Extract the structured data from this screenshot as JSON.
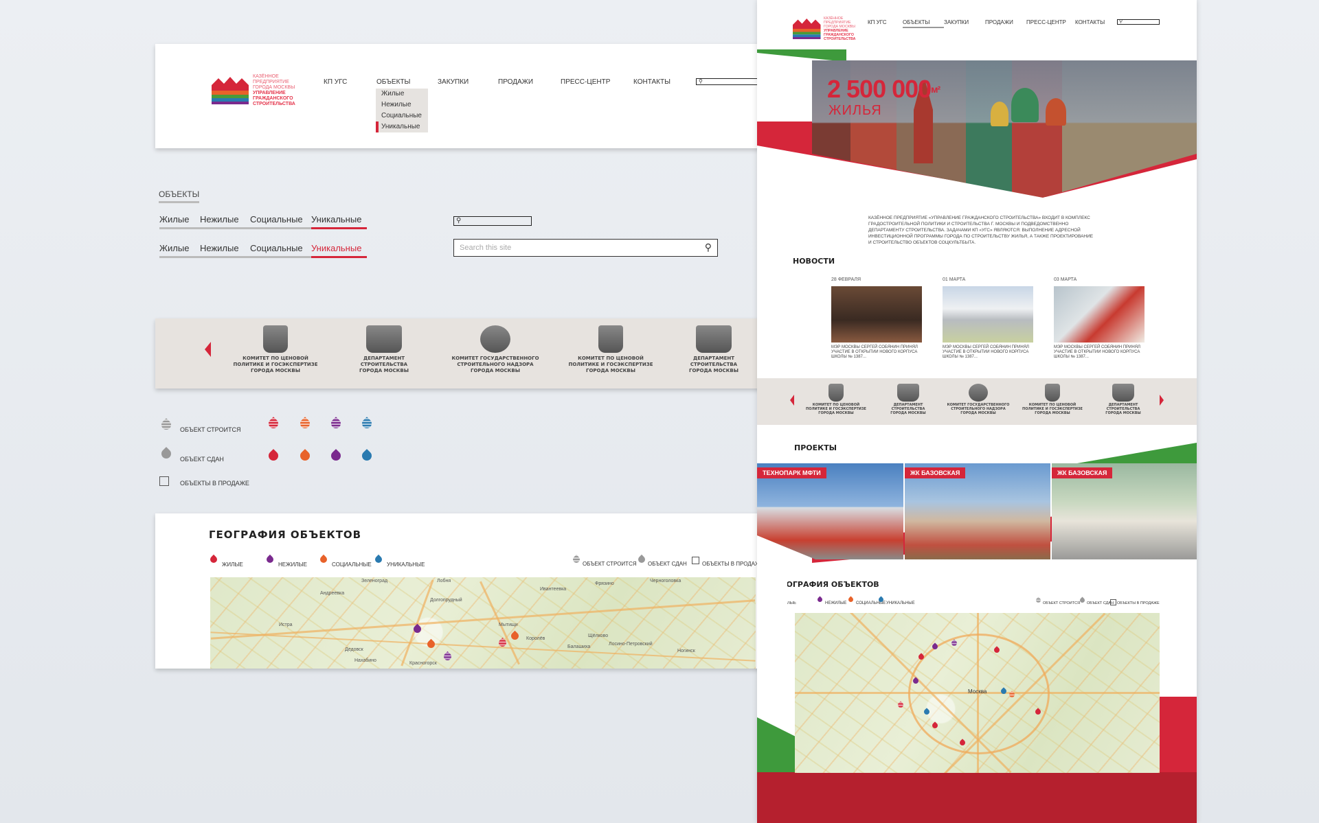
{
  "logo": {
    "line1": "КАЗЁННОЕ",
    "line2": "ПРЕДПРИЯТИЕ",
    "line3": "ГОРОДА МОСКВЫ",
    "line4": "УПРАВЛЕНИЕ",
    "line5": "ГРАЖДАНСКОГО",
    "line6": "СТРОИТЕЛЬСТВА"
  },
  "nav": {
    "items": [
      "КП УГС",
      "ОБЪЕКТЫ",
      "ЗАКУПКИ",
      "ПРОДАЖИ",
      "ПРЕСС-ЦЕНТР",
      "КОНТАКТЫ"
    ]
  },
  "dropdown": {
    "items": [
      "Жилые",
      "Нежилые",
      "Социальные",
      "Уникальные"
    ]
  },
  "objects_section": {
    "title": "ОБЪЕКТЫ",
    "tabs": [
      "Жилые",
      "Нежилые",
      "Социальные",
      "Уникальные"
    ]
  },
  "search": {
    "placeholder": "Search this site"
  },
  "carousel": {
    "items": [
      {
        "l1": "КОМИТЕТ ПО ЦЕНОВОЙ",
        "l2": "ПОЛИТИКЕ И ГОСЭКСПЕРТИЗЕ",
        "l3": "ГОРОДА МОСКВЫ"
      },
      {
        "l1": "ДЕПАРТАМЕНТ",
        "l2": "СТРОИТЕЛЬСТВА",
        "l3": "ГОРОДА МОСКВЫ"
      },
      {
        "l1": "КОМИТЕТ ГОСУДАРСТВЕННОГО",
        "l2": "СТРОИТЕЛЬНОГО НАДЗОРА",
        "l3": "ГОРОДА МОСКВЫ"
      },
      {
        "l1": "КОМИТЕТ ПО ЦЕНОВОЙ",
        "l2": "ПОЛИТИКЕ И ГОСЭКСПЕРТИЗЕ",
        "l3": "ГОРОДА МОСКВЫ"
      },
      {
        "l1": "ДЕПАРТАМЕНТ",
        "l2": "СТРОИТЕЛЬСТВА",
        "l3": "ГОРОДА МОСКВЫ"
      }
    ]
  },
  "legend": {
    "building": "ОБЪЕКТ СТРОИТСЯ",
    "done": "ОБЪЕКТ СДАН",
    "sale": "ОБЪЕКТЫ В ПРОДАЖЕ",
    "colors": [
      "#d5263a",
      "#e8622a",
      "#7a2a8e",
      "#2a7ab0"
    ]
  },
  "geo": {
    "title": "ГЕОГРАФИЯ ОБЪЕКТОВ",
    "types": [
      "ЖИЛЫЕ",
      "НЕЖИЛЫЕ",
      "СОЦИАЛЬНЫЕ",
      "УНИКАЛЬНЫЕ"
    ],
    "status": [
      "ОБЪЕКТ СТРОИТСЯ",
      "ОБЪЕКТ СДАН",
      "ОБЪЕКТЫ В ПРОДАЖЕ"
    ]
  },
  "map_towns": [
    "Зеленоград",
    "Андреевка",
    "Лобня",
    "Долгопрудный",
    "Ивантеевка",
    "Фрязино",
    "Черноголовка",
    "Истра",
    "Мытищи",
    "Королёв",
    "Щёлково",
    "Дедовск",
    "Балашиха",
    "Лосино-Петровский",
    "Ногинск",
    "Нахабино",
    "Красногорск",
    "Москва"
  ],
  "hero": {
    "number": "2 500 000",
    "unit": "м²",
    "caption": "ЖИЛЬЯ"
  },
  "about": {
    "text": "КАЗЁННОЕ ПРЕДПРИЯТИЕ «УПРАВЛЕНИЕ ГРАЖДАНСКОГО СТРОИТЕЛЬСТВА» ВХОДИТ В КОМПЛЕКС ГРАДОСТРОИТЕЛЬНОЙ ПОЛИТИКИ И СТРОИТЕЛЬСТВА Г. МОСКВЫ И ПОДВЕДОМСТВЕННО ДЕПАРТАМЕНТУ СТРОИТЕЛЬСТВА. ЗАДАЧАМИ КП «УГС» ЯВЛЯЮТСЯ: ВЫПОЛНЕНИЕ АДРЕСНОЙ ИНВЕСТИЦИОННОЙ ПРОГРАММЫ ГОРОДА ПО СТРОИТЕЛЬСТВУ ЖИЛЬЯ, А ТАКЖЕ ПРОЕКТИРОВАНИЕ И СТРОИТЕЛЬСТВО ОБЪЕКТОВ СОЦКУЛЬТБЫТА."
  },
  "news": {
    "title": "НОВОСТИ",
    "items": [
      {
        "date": "28 ФЕВРАЛЯ",
        "text": "МЭР МОСКВЫ СЕРГЕЙ СОБЯНИН ПРИНЯЛ УЧАСТИЕ В ОТКРЫТИИ НОВОГО КОРПУСА ШКОЛЫ № 1387..."
      },
      {
        "date": "01 МАРТА",
        "text": "МЭР МОСКВЫ СЕРГЕЙ СОБЯНИН ПРИНЯЛ УЧАСТИЕ В ОТКРЫТИИ НОВОГО КОРПУСА ШКОЛЫ № 1387..."
      },
      {
        "date": "03 МАРТА",
        "text": "МЭР МОСКВЫ СЕРГЕЙ СОБЯНИН ПРИНЯЛ УЧАСТИЕ В ОТКРЫТИИ НОВОГО КОРПУСА ШКОЛЫ № 1387..."
      }
    ]
  },
  "projects": {
    "title": "ПРОЕКТЫ",
    "items": [
      "ТЕХНОПАРК МФТИ",
      "ЖК БАЗОВСКАЯ",
      "ЖК БАЗОВСКАЯ"
    ]
  },
  "geo_right": {
    "title": "ГЕОГРАФИЯ ОБЪЕКТОВ",
    "types": [
      "ЖИЛЫЕ",
      "НЕЖИЛЫЕ",
      "СОЦИАЛЬНЫЕ",
      "УНИКАЛЬНЫЕ"
    ],
    "status": [
      "ОБЪЕКТ СТРОИТСЯ",
      "ОБЪЕКТ СДАН",
      "ОБЪЕКТЫ В ПРОДАЖЕ"
    ],
    "city": "Москва"
  }
}
